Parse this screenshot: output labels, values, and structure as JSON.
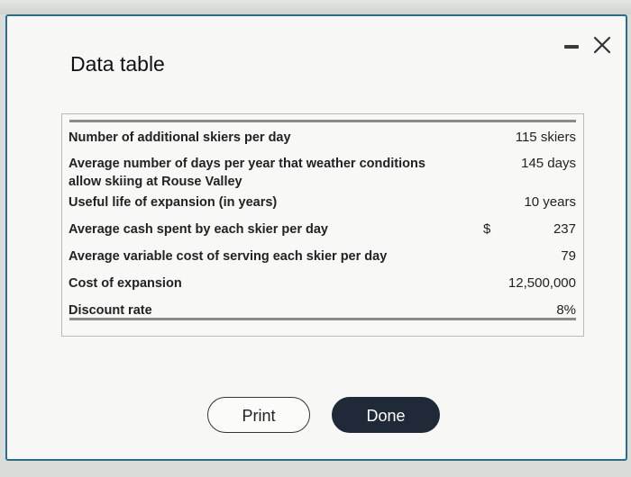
{
  "dialog": {
    "title": "Data table"
  },
  "table": {
    "rows": [
      {
        "label": "Number of additional skiers per day",
        "currency": "",
        "value": "115 skiers"
      },
      {
        "label": "Average number of days per year that weather conditions allow skiing at Rouse Valley",
        "currency": "",
        "value": "145 days"
      },
      {
        "label": "Useful life of expansion (in years)",
        "currency": "",
        "value": "10 years"
      },
      {
        "label": "Average cash spent by each skier per day",
        "currency": "$",
        "value": "237"
      },
      {
        "label": "Average variable cost of serving each skier per day",
        "currency": "",
        "value": "79"
      },
      {
        "label": "Cost of expansion",
        "currency": "",
        "value": "12,500,000"
      },
      {
        "label": "Discount rate",
        "currency": "",
        "value": "8%"
      }
    ]
  },
  "buttons": {
    "print_label": "Print",
    "done_label": "Done"
  },
  "colors": {
    "dialog_border": "#2e6c8e",
    "done_background": "#1f2937"
  },
  "icons": {
    "minimize": "minimize-icon",
    "close": "close-icon"
  }
}
